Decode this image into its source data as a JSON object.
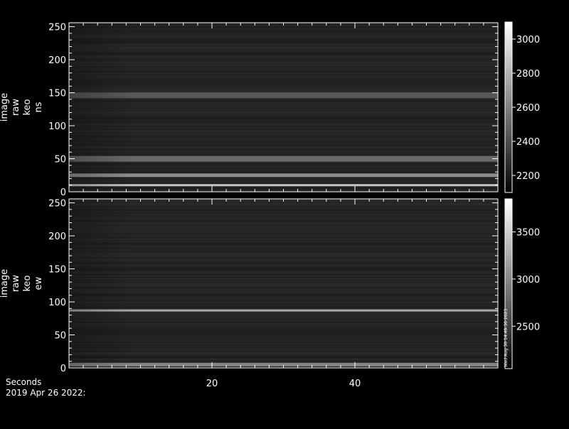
{
  "footer": {
    "xunits": "Seconds",
    "date": "2019 Apr 26 2022:"
  },
  "colors": {
    "background": "#000000",
    "foreground": "#ffffff"
  },
  "chart_data": [
    {
      "type": "heatmap",
      "ylabel_lines": [
        "image",
        "raw",
        "keo",
        "ns"
      ],
      "x_range": [
        0,
        60
      ],
      "x_ticks": [
        20,
        40
      ],
      "ylim": [
        0,
        256
      ],
      "y_ticks": [
        0,
        50,
        100,
        150,
        200,
        250
      ],
      "colorbar": {
        "range": [
          2100,
          3100
        ],
        "ticks": [
          2200,
          2400,
          2600,
          2800,
          3000
        ]
      },
      "bright_rows": [
        {
          "y": 10,
          "level": 0.92
        },
        {
          "y": 25,
          "level": 0.6
        },
        {
          "y": 50,
          "level": 0.38
        },
        {
          "y": 146,
          "level": 0.28
        }
      ]
    },
    {
      "type": "heatmap",
      "ylabel_lines": [
        "image",
        "raw",
        "keo",
        "ew"
      ],
      "x_range": [
        0,
        60
      ],
      "x_ticks": [
        20,
        40
      ],
      "ylim": [
        0,
        256
      ],
      "y_ticks": [
        0,
        50,
        100,
        150,
        200,
        250
      ],
      "colorbar": {
        "range": [
          2050,
          3850
        ],
        "ticks": [
          2500,
          3000,
          3500
        ]
      },
      "bright_rows": [
        {
          "y": 87,
          "level": 0.75
        },
        {
          "y": 5,
          "level": 0.55
        }
      ],
      "stamp": "Wed Aug 30 14:49:36 2023"
    }
  ]
}
